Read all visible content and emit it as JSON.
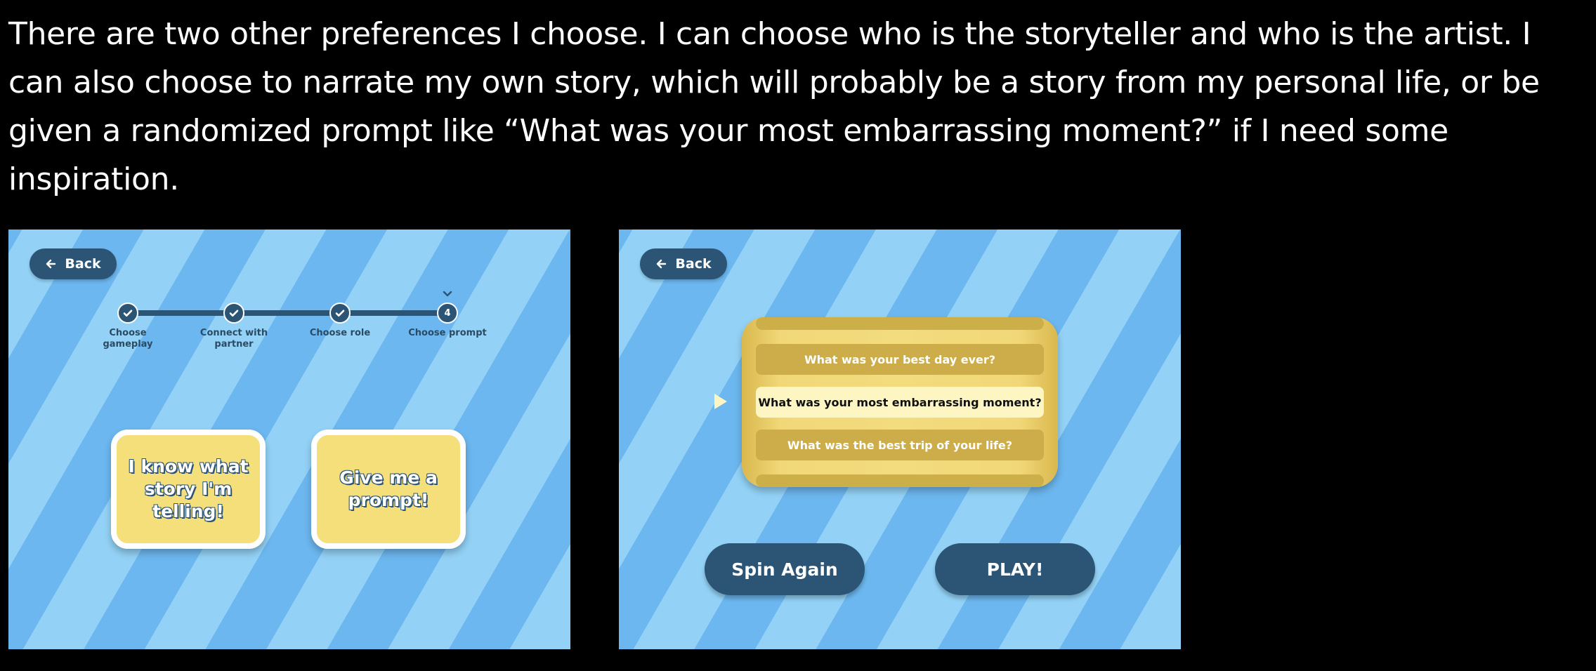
{
  "intro_text": "There are two other preferences I choose. I can choose who is the storyteller and who is the artist. I can also choose to narrate my own story, which will probably be a story from my personal life, or be given a randomized prompt like “What was your most embarrassing moment?” if I need some inspiration.",
  "left_screen": {
    "back_label": "Back",
    "steps": [
      {
        "label": "Choose gameplay",
        "state": "done"
      },
      {
        "label": "Connect with partner",
        "state": "done"
      },
      {
        "label": "Choose role",
        "state": "done"
      },
      {
        "label": "Choose prompt",
        "state": "current",
        "number": "4"
      }
    ],
    "choices": {
      "own_story": "I know what story I'm telling!",
      "prompt": "Give me a prompt!"
    }
  },
  "right_screen": {
    "back_label": "Back",
    "prompts": [
      "What was your best day ever?",
      "What was your most embarrassing moment?",
      "What was the best trip of your life?"
    ],
    "selected_index": 1,
    "spin_again_label": "Spin Again",
    "play_label": "PLAY!"
  },
  "colors": {
    "background": "#000000",
    "stripe_light": "#93d2f6",
    "stripe_dark": "#6cb7ef",
    "navy": "#2b5475",
    "card_yellow": "#f5df7a",
    "spinner_item": "#ccad49",
    "spinner_selected": "#fdf6c3"
  },
  "icons": {
    "back": "arrow-left-icon",
    "done_step": "check-icon",
    "current_step_marker": "chevron-down-icon",
    "spinner_pointer": "triangle-pointer-icon"
  }
}
